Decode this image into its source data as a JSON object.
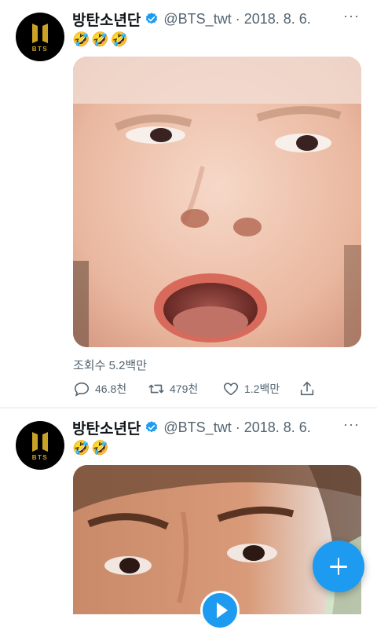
{
  "colors": {
    "accent": "#1d9bf0",
    "secondary_text": "#536471",
    "logo_gold": "#c9a227"
  },
  "tweets": [
    {
      "author_name": "방탄소년단",
      "handle_date": "@BTS_twt · 2018. 8. 6.",
      "emoji": "🤣🤣🤣",
      "avatar_text": "BTS",
      "views": "조회수 5.2백만",
      "replies": "46.8천",
      "retweets": "479천",
      "likes": "1.2백만",
      "more": "···"
    },
    {
      "author_name": "방탄소년단",
      "handle_date": "@BTS_twt · 2018. 8. 6.",
      "emoji": "🤣🤣",
      "avatar_text": "BTS",
      "more": "···"
    }
  ],
  "icons": {
    "verified": "verified-badge-icon",
    "reply": "reply-icon",
    "retweet": "retweet-icon",
    "like": "heart-icon",
    "share": "share-icon",
    "compose": "plus-icon",
    "play": "play-icon"
  }
}
